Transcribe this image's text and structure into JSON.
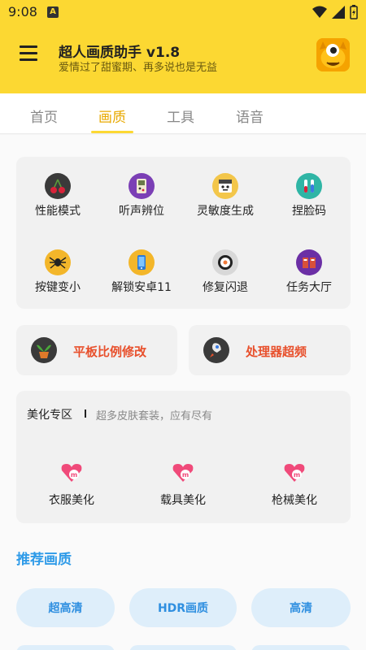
{
  "status": {
    "time": "9:08",
    "badge": "A"
  },
  "header": {
    "title": "超人画质助手 v1.8",
    "subtitle": "爱情过了甜蜜期、再多说也是无益",
    "menu_icon": "hamburger-menu-icon",
    "avatar_icon": "yellow-monster-avatar-icon",
    "brand_color": "#fcd832"
  },
  "tabs": [
    {
      "label": "首页"
    },
    {
      "label": "画质"
    },
    {
      "label": "工具"
    },
    {
      "label": "语音"
    }
  ],
  "active_tab": "画质",
  "grid": [
    {
      "label": "性能模式",
      "icon": "cherry-icon"
    },
    {
      "label": "听声辨位",
      "icon": "gameboy-icon"
    },
    {
      "label": "灵敏度生成",
      "icon": "face-icon"
    },
    {
      "label": "捏脸码",
      "icon": "test-tubes-icon"
    },
    {
      "label": "按键变小",
      "icon": "spider-icon"
    },
    {
      "label": "解锁安卓11",
      "icon": "phone-icon"
    },
    {
      "label": "修复闪退",
      "icon": "sushi-icon"
    },
    {
      "label": "任务大厅",
      "icon": "lockers-icon"
    }
  ],
  "quick": [
    {
      "label": "平板比例修改",
      "icon": "potted-plant-icon"
    },
    {
      "label": "处理器超频",
      "icon": "rocket-icon"
    }
  ],
  "beauty": {
    "title": "美化专区",
    "subtitle": "超多皮肤套装，应有尽有",
    "items": [
      {
        "label": "衣服美化",
        "icon": "pink-heart-m-icon"
      },
      {
        "label": "载具美化",
        "icon": "pink-heart-m-icon"
      },
      {
        "label": "枪械美化",
        "icon": "pink-heart-m-icon"
      }
    ]
  },
  "recommend": {
    "title": "推荐画质",
    "chips": [
      {
        "label": "超高清"
      },
      {
        "label": "HDR画质"
      },
      {
        "label": "高清"
      }
    ],
    "accent": "#2f9be8"
  }
}
